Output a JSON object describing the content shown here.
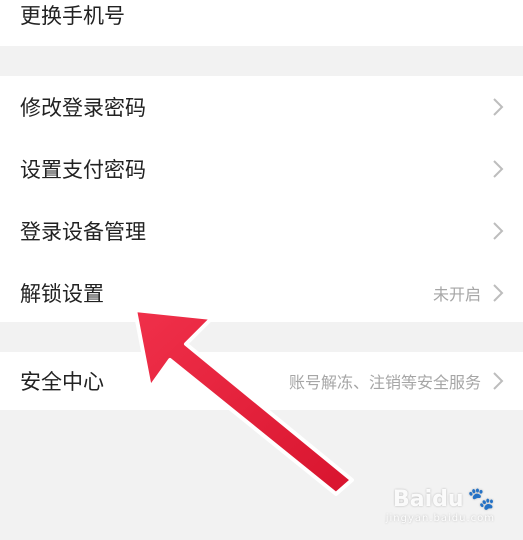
{
  "top_item": {
    "label": "更换手机号"
  },
  "security_group": {
    "items": [
      {
        "label": "修改登录密码",
        "value": ""
      },
      {
        "label": "设置支付密码",
        "value": ""
      },
      {
        "label": "登录设备管理",
        "value": ""
      },
      {
        "label": "解锁设置",
        "value": "未开启"
      }
    ]
  },
  "safety_center": {
    "label": "安全中心",
    "value": "账号解冻、注销等安全服务"
  },
  "watermark": {
    "brand": "Baidu",
    "sub": "jingyan.baidu.com"
  },
  "colors": {
    "arrow": "#e8213a",
    "chevron": "#bdbdbd",
    "background": "#f2f2f2"
  },
  "icons": {
    "row_chevron": "chevron-right-icon",
    "watermark_logo": "baidu-paw-icon"
  }
}
